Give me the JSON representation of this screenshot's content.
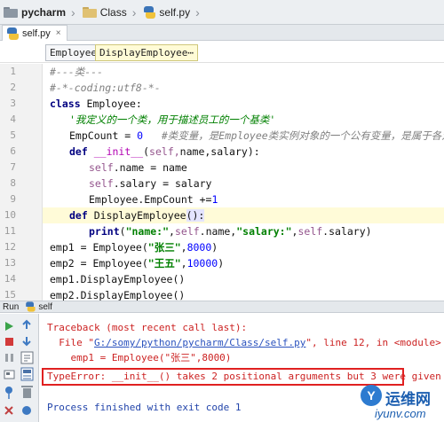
{
  "breadcrumb": {
    "project": "pycharm",
    "folder": "Class",
    "file": "self.py"
  },
  "tabs": {
    "file_tab": "self.py",
    "close_glyph": "×"
  },
  "structure": {
    "chip_class": "Employee",
    "chip_method": "DisplayEmployee⋯"
  },
  "editor": {
    "line_numbers": [
      "1",
      "2",
      "3",
      "4",
      "5",
      "6",
      "7",
      "8",
      "9",
      "10",
      "11",
      "12",
      "13",
      "14",
      "15"
    ],
    "l1": "#---类---",
    "l2": "#-*-coding:utf8-*-",
    "l3_kw": "class",
    "l3_rest": " Employee:",
    "l4": "'我定义的一个类，用于描述员工的一个基类'",
    "l5_code": "EmpCount = ",
    "l5_num": "0",
    "l5_comment": "   #类变量，是Employee类实例对象的一个公有变量，是属于各对象共",
    "l6_kw": "def",
    "l6_fn": "__init__",
    "l6_open": "(",
    "l6_params": "name,salary):",
    "l6_self": "self,",
    "l7_self": "self",
    "l7_rest": ".name = name",
    "l8_self": "self",
    "l8_rest": ".salary = salary",
    "l9": "Employee.EmpCount +=",
    "l9_num": "1",
    "l10_kw": "def",
    "l10_fn": "DisplayEmployee",
    "l10_rest": "():",
    "l11_kw": "print",
    "l11_open": "(",
    "l11_s1": "\"name:\"",
    "l11_mid": ",",
    "l11_self1": "self",
    "l11_mid2": ".name,",
    "l11_s2": "\"salary:\"",
    "l11_mid3": ",",
    "l11_self2": "self",
    "l11_end": ".salary)",
    "l12_a": "emp1 = Employee(",
    "l12_s": "\"张三\"",
    "l12_b": ",",
    "l12_n": "8000",
    "l12_c": ")",
    "l13_a": "emp2 = Employee(",
    "l13_s": "\"王五\"",
    "l13_b": ",",
    "l13_n": "10000",
    "l13_c": ")",
    "l14": "emp1.DisplayEmployee()",
    "l15": "emp2.DisplayEmployee()"
  },
  "run": {
    "label": "Run",
    "config": "self"
  },
  "console": {
    "traceback": "Traceback (most recent call last):",
    "file_prefix": "  File \"",
    "file_link": "G:/somy/python/pycharm/Class/self.py",
    "file_suffix": "\", line 12, in <module>",
    "code_line": "    emp1 = Employee(\"张三\",8000)",
    "error": "TypeError: __init__() takes 2 positional arguments but 3 were given",
    "finished": "Process finished with exit code 1"
  },
  "watermark": {
    "cn": "运维网",
    "url": "iyunv.com",
    "logo_glyph": "Y"
  },
  "colors": {
    "error_box": "#e02020",
    "console_error_text": "#cc2222",
    "console_link": "#2a52be",
    "current_line": "#fffbd8",
    "keyword": "#000080"
  }
}
